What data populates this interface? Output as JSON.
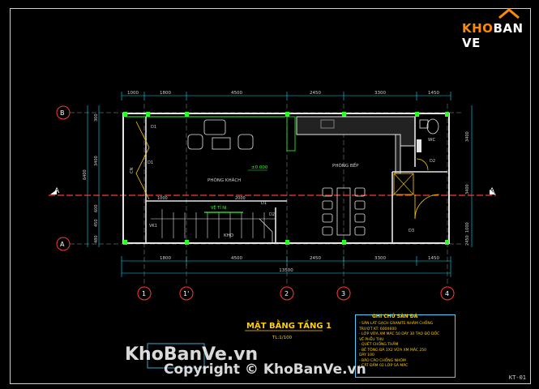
{
  "brand": {
    "logo_text_a": "KHO",
    "logo_text_b": "BAN VE"
  },
  "drawing": {
    "title": "MẶT BẰNG TẦNG 1",
    "scale": "TL:1/100",
    "sheet_code": "KT-01",
    "rooms": {
      "living": "PHÒNG KHÁCH",
      "kitchen": "PHÒNG BẾP",
      "wc": "WC",
      "storage": "KHO",
      "skylight": "VỆ TỈ NỊ"
    },
    "elevation_mark": "±0.000",
    "section_mark": "A",
    "grid_rows": [
      "B",
      "A"
    ],
    "grid_cols": [
      "1",
      "1'",
      "2",
      "3",
      "4"
    ],
    "dims_top": [
      "1000",
      "1800",
      "4500",
      "2450",
      "3300",
      "1450"
    ],
    "dims_bottom": [
      "1800",
      "4500",
      "2450",
      "3300",
      "1450"
    ],
    "dims_total": "13500",
    "dims_left": [
      "300",
      "3400",
      "600",
      "450",
      "480"
    ],
    "dims_left_total": "6400",
    "dims_right": [
      "3400",
      "3400",
      "1000",
      "2450"
    ],
    "door_tags": [
      "D1",
      "D1",
      "D2",
      "D3",
      "D2",
      "D1"
    ],
    "stair_dims": [
      "1000",
      "2000"
    ],
    "window_tags": [
      "VK1",
      "CN"
    ],
    "notes_title": "GHI CHÚ SÀN ĐÁ",
    "notes": [
      "- SÀN LÁT GẠCH GRANITE NHÁM CHỐNG",
      "  TRƯỢT KT: 600X600",
      "- LỚP VỮA XM MÁC 50 DÀY 30 TẠO ĐỘ DỐC",
      "  VỀ PHỄU THU",
      "- QUÉT CHỐNG THẤM",
      "- BÊ TÔNG ĐÁ 1X2 VỮA XM MÁC 250",
      "  DÀY 100",
      "- BÁO CÁO CHỐNG NHÓM",
      "- CÁT ĐẦM 02 LỚP SÀ MÁC"
    ]
  },
  "watermark": {
    "line1": "KhoBanVe.vn",
    "line2": "Copyright © KhoBanVe.vn"
  },
  "colors": {
    "grid": "#ff3a3a",
    "wall": "#e6e6e6",
    "dim": "#00e0ff",
    "text": "#ffd000",
    "green": "#2cff2c"
  }
}
